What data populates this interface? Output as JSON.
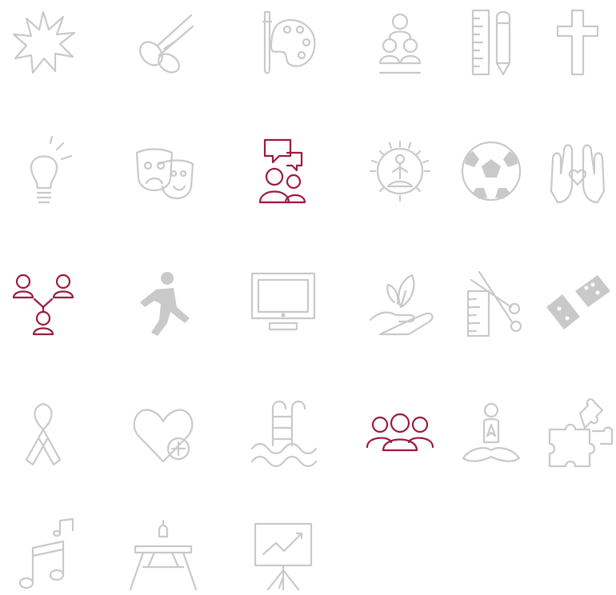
{
  "colors": {
    "inactive": "#c9c9c9",
    "active": "#9a1c3c",
    "background": "#ffffff"
  },
  "tiles": [
    {
      "icon": "burst-icon",
      "state": "inactive"
    },
    {
      "icon": "scissors-icon",
      "state": "inactive"
    },
    {
      "icon": "paint-palette-icon",
      "state": "inactive"
    },
    {
      "icon": "group-hierarchy-icon",
      "state": "inactive"
    },
    {
      "icon": "ruler-pencil-icon",
      "state": "inactive"
    },
    {
      "icon": "cross-icon",
      "state": "inactive"
    },
    {
      "icon": "light-bulb-icon",
      "state": "inactive"
    },
    {
      "icon": "theater-masks-icon",
      "state": "inactive"
    },
    {
      "icon": "discussion-group-icon",
      "state": "active"
    },
    {
      "icon": "meditation-sun-icon",
      "state": "inactive"
    },
    {
      "icon": "soccer-ball-icon",
      "state": "inactive"
    },
    {
      "icon": "hands-heart-icon",
      "state": "inactive"
    },
    {
      "icon": "network-people-icon",
      "state": "active"
    },
    {
      "icon": "running-person-icon",
      "state": "inactive"
    },
    {
      "icon": "monitor-icon",
      "state": "inactive"
    },
    {
      "icon": "hand-plant-icon",
      "state": "inactive"
    },
    {
      "icon": "sewing-scissors-ruler-icon",
      "state": "inactive"
    },
    {
      "icon": "dominoes-icon",
      "state": "inactive"
    },
    {
      "icon": "awareness-ribbon-icon",
      "state": "inactive"
    },
    {
      "icon": "heart-plus-icon",
      "state": "inactive"
    },
    {
      "icon": "swimming-pool-ladder-icon",
      "state": "inactive"
    },
    {
      "icon": "people-group-icon",
      "state": "active"
    },
    {
      "icon": "yoga-lotus-icon",
      "state": "inactive"
    },
    {
      "icon": "puzzle-pieces-icon",
      "state": "inactive"
    },
    {
      "icon": "music-notes-icon",
      "state": "inactive"
    },
    {
      "icon": "picnic-table-icon",
      "state": "inactive"
    },
    {
      "icon": "presentation-board-icon",
      "state": "inactive"
    }
  ]
}
